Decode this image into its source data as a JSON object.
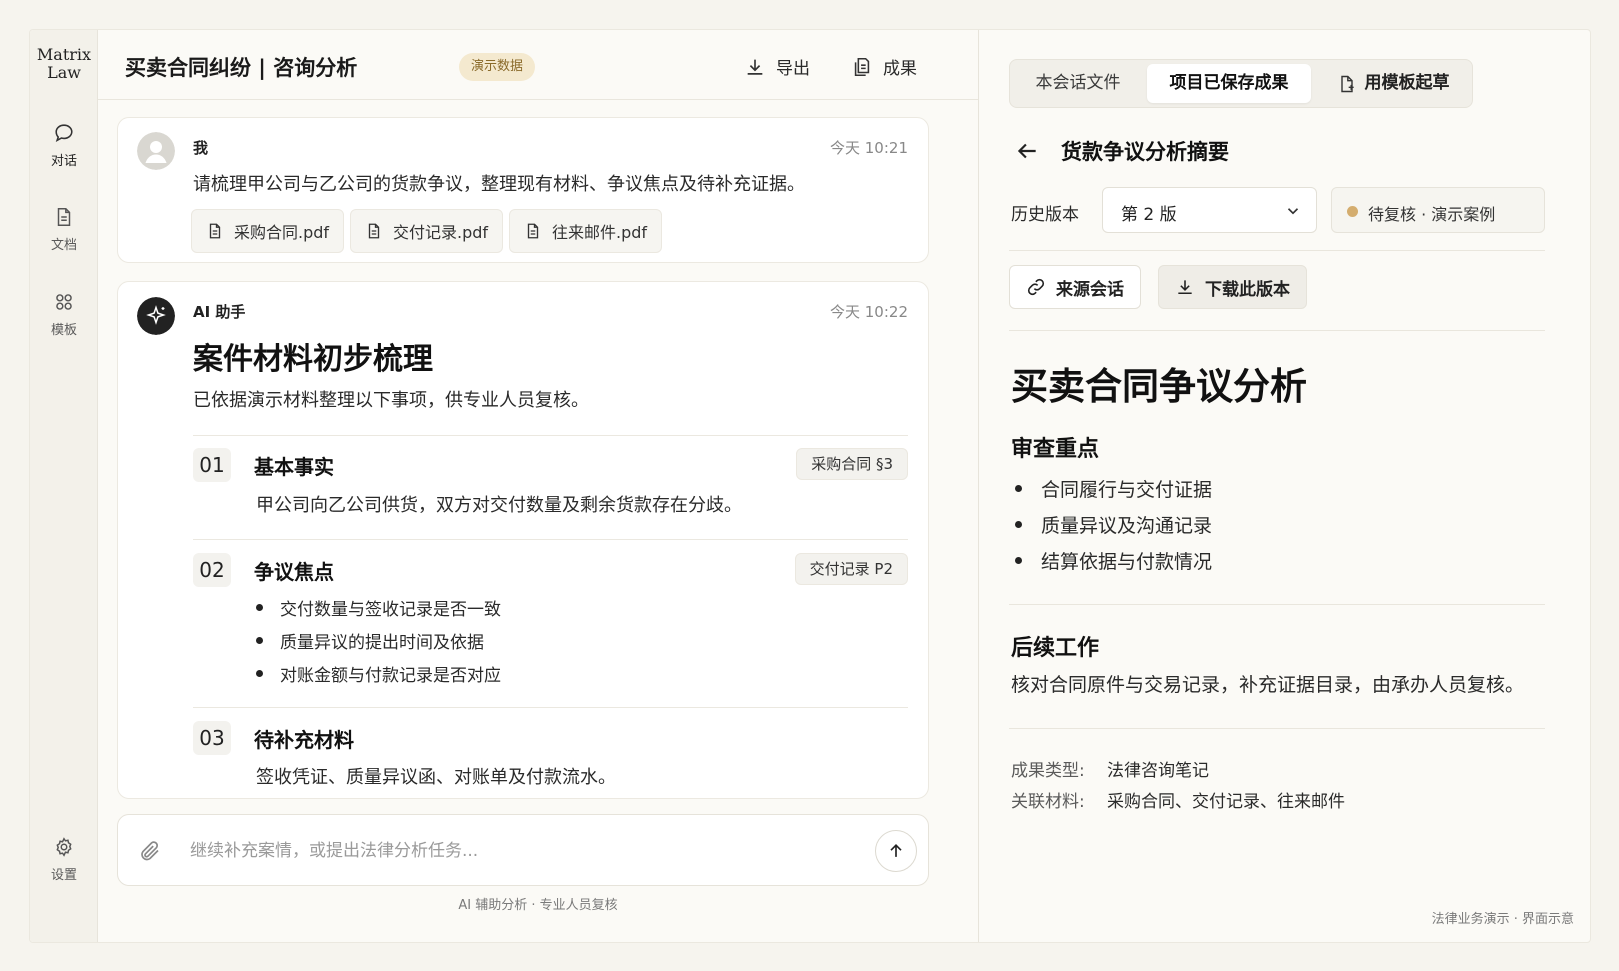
{
  "brand": {
    "line1": "Matrix",
    "line2": "Law"
  },
  "rail": {
    "chat_label": "对话",
    "docs_label": "文档",
    "templates_label": "模板",
    "settings_label": "设置"
  },
  "header": {
    "title": "买卖合同纠纷 | 咨询分析",
    "badge": "演示数据",
    "export_label": "导出",
    "results_label": "成果"
  },
  "user_msg": {
    "sender": "我",
    "time": "今天 10:21",
    "text": "请梳理甲公司与乙公司的货款争议，整理现有材料、争议焦点及待补充证据。",
    "attachments": [
      "采购合同.pdf",
      "交付记录.pdf",
      "往来邮件.pdf"
    ]
  },
  "ai_msg": {
    "sender": "AI 助手",
    "time": "今天 10:22",
    "title": "案件材料初步梳理",
    "intro": "已依据演示材料整理以下事项，供专业人员复核。",
    "sections": [
      {
        "num": "01",
        "title": "基本事实",
        "ref": "采购合同 §3",
        "text": "甲公司向乙公司供货，双方对交付数量及剩余货款存在分歧。"
      },
      {
        "num": "02",
        "title": "争议焦点",
        "ref": "交付记录 P2",
        "bullets": [
          "交付数量与签收记录是否一致",
          "质量异议的提出时间及依据",
          "对账金额与付款记录是否对应"
        ]
      },
      {
        "num": "03",
        "title": "待补充材料",
        "text": "签收凭证、质量异议函、对账单及付款流水。"
      }
    ]
  },
  "composer": {
    "placeholder": "继续补充案情，或提出法律分析任务...",
    "footnote": "AI 辅助分析 · 专业人员复核"
  },
  "right": {
    "tabs": [
      "本会话文件",
      "项目已保存成果",
      "用模板起草"
    ],
    "title": "货款争议分析摘要",
    "history_label": "历史版本",
    "version": "第 2 版",
    "status": "待复核 · 演示案例",
    "source_btn": "来源会话",
    "download_btn": "下载此版本",
    "doc_title": "买卖合同争议分析",
    "review_heading": "审查重点",
    "review_items": [
      "合同履行与交付证据",
      "质量异议及沟通记录",
      "结算依据与付款情况"
    ],
    "followup_heading": "后续工作",
    "followup_text": "核对合同原件与交易记录，补充证据目录，由承办人员复核。",
    "meta_type_key": "成果类型:",
    "meta_type_val": "法律咨询笔记",
    "meta_mat_key": "关联材料:",
    "meta_mat_val": "采购合同、交付记录、往来邮件",
    "footer": "法律业务演示 · 界面示意"
  },
  "colors": {
    "accent_badge_bg": "#f4e9cf",
    "status_dot": "#d4ad6e"
  }
}
